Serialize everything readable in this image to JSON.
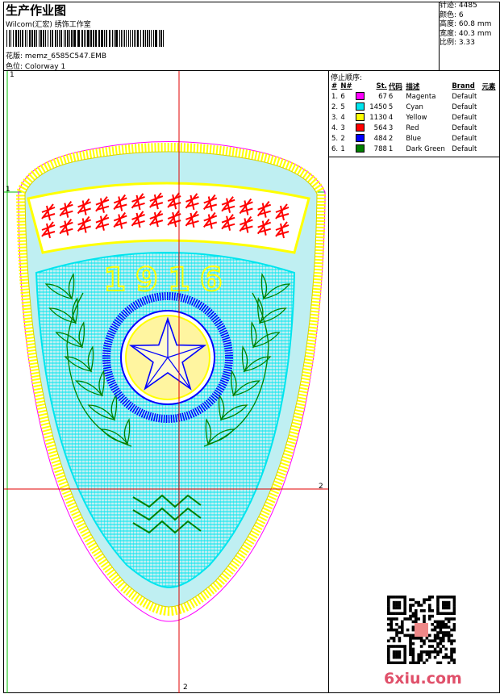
{
  "header": {
    "title": "生产作业图",
    "company": "Wilcom(汇宏) 绣饰工作室",
    "design_label": "花版:",
    "design_value": "memz_6585C547.EMB",
    "colorway_label": "色位:",
    "colorway_value": "Colorway 1"
  },
  "stats": [
    {
      "label": "针迹:",
      "value": "4485"
    },
    {
      "label": "颜色:",
      "value": "6"
    },
    {
      "label": "高度:",
      "value": "60.8 mm"
    },
    {
      "label": "宽度:",
      "value": "40.3 mm"
    },
    {
      "label": "比例:",
      "value": "3.33"
    }
  ],
  "stop_sequence": {
    "heading": "停止顺序:",
    "columns": [
      "#",
      "N#",
      "St.",
      "代码",
      "描述",
      "Brand",
      "元素"
    ],
    "rows": [
      {
        "num": "1.",
        "needle": "6",
        "color": "#ff00ff",
        "stitches": "67",
        "code": "6",
        "desc": "Magenta",
        "brand": "Default"
      },
      {
        "num": "2.",
        "needle": "5",
        "color": "#00e5ee",
        "stitches": "1450",
        "code": "5",
        "desc": "Cyan",
        "brand": "Default"
      },
      {
        "num": "3.",
        "needle": "4",
        "color": "#ffff00",
        "stitches": "1130",
        "code": "4",
        "desc": "Yellow",
        "brand": "Default"
      },
      {
        "num": "4.",
        "needle": "3",
        "color": "#ff0000",
        "stitches": "564",
        "code": "3",
        "desc": "Red",
        "brand": "Default"
      },
      {
        "num": "5.",
        "needle": "2",
        "color": "#0000ff",
        "stitches": "484",
        "code": "2",
        "desc": "Blue",
        "brand": "Default"
      },
      {
        "num": "6.",
        "needle": "1",
        "color": "#008000",
        "stitches": "788",
        "code": "1",
        "desc": "Dark Green",
        "brand": "Default"
      }
    ]
  },
  "canvas": {
    "axis_labels": {
      "top": "1",
      "left": "1",
      "right": "2",
      "bottom": "2"
    },
    "badge_year": "1916"
  },
  "watermark": "6xiu.com"
}
